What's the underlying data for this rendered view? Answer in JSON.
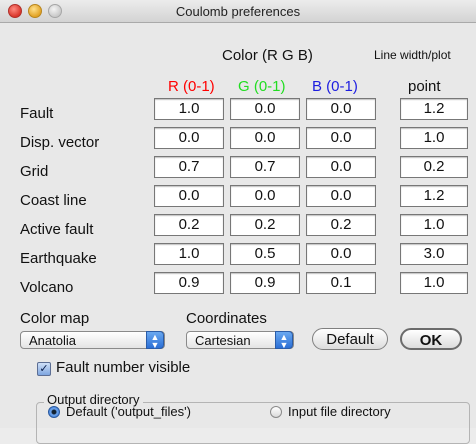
{
  "window": {
    "title": "Coulomb preferences"
  },
  "headers": {
    "color": "Color (R G B)",
    "line_width": "Line width/plot",
    "r": "R (0-1)",
    "g": "G (0-1)",
    "b": "B (0-1)",
    "point": "point"
  },
  "colors": {
    "r_label": "#ff0000",
    "g_label": "#22dd22",
    "b_label": "#1d1de0"
  },
  "rows": [
    {
      "label": "Fault",
      "r": "1.0",
      "g": "0.0",
      "b": "0.0",
      "point": "1.2"
    },
    {
      "label": "Disp. vector",
      "r": "0.0",
      "g": "0.0",
      "b": "0.0",
      "point": "1.0"
    },
    {
      "label": "Grid",
      "r": "0.7",
      "g": "0.7",
      "b": "0.0",
      "point": "0.2"
    },
    {
      "label": "Coast line",
      "r": "0.0",
      "g": "0.0",
      "b": "0.0",
      "point": "1.2"
    },
    {
      "label": "Active fault",
      "r": "0.2",
      "g": "0.2",
      "b": "0.2",
      "point": "1.0"
    },
    {
      "label": "Earthquake",
      "r": "1.0",
      "g": "0.5",
      "b": "0.0",
      "point": "3.0"
    },
    {
      "label": "Volcano",
      "r": "0.9",
      "g": "0.9",
      "b": "0.1",
      "point": "1.0"
    }
  ],
  "color_map": {
    "label": "Color map",
    "value": "Anatolia"
  },
  "coordinates": {
    "label": "Coordinates",
    "value": "Cartesian"
  },
  "buttons": {
    "default": "Default",
    "ok": "OK"
  },
  "fault_number": {
    "label": "Fault number visible",
    "checked": true
  },
  "output": {
    "legend": "Output directory",
    "option_default": "Default ('output_files')",
    "option_input": "Input file directory",
    "selected": "default"
  }
}
